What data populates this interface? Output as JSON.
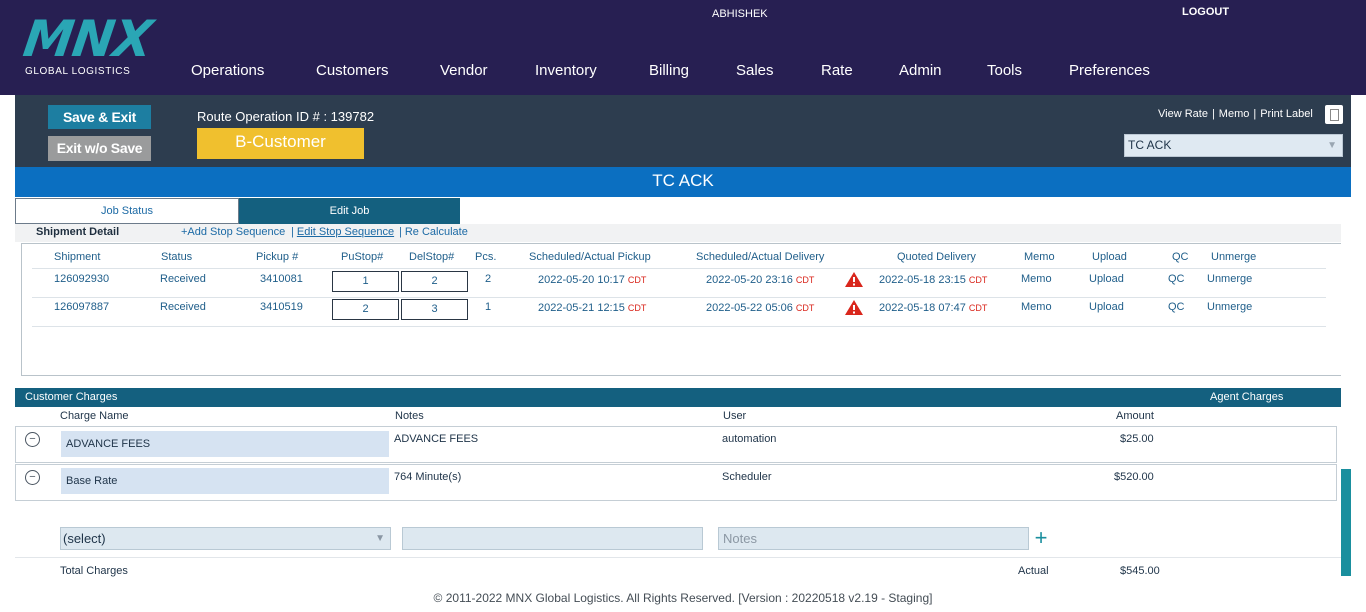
{
  "header": {
    "logo_mark": "MNX",
    "logo_sub": "GLOBAL LOGISTICS",
    "username": "ABHISHEK",
    "logout": "LOGOUT",
    "nav": [
      "Operations",
      "Customers",
      "Vendor",
      "Inventory",
      "Billing",
      "Sales",
      "Rate",
      "Admin",
      "Tools",
      "Preferences"
    ]
  },
  "toolbar": {
    "save_exit": "Save & Exit",
    "exit_wo_save": "Exit w/o Save",
    "route_id": "Route Operation ID # : 139782",
    "customer_tag": "B-Customer",
    "view_rate": "View Rate",
    "memo": "Memo",
    "print_label": "Print Label",
    "status_value": "TC ACK"
  },
  "title": "TC ACK",
  "tabs": {
    "job_status": "Job Status",
    "edit_job": "Edit Job"
  },
  "shipment_detail": {
    "title": "Shipment Detail",
    "add_stop": "+Add Stop Sequence",
    "edit_stop": "Edit Stop Sequence",
    "recalc": "Re Calculate",
    "columns": [
      "Shipment",
      "Status",
      "Pickup #",
      "PuStop#",
      "DelStop#",
      "Pcs.",
      "Scheduled/Actual Pickup",
      "Scheduled/Actual Delivery",
      "Quoted Delivery",
      "Memo",
      "Upload",
      "QC",
      "Unmerge"
    ],
    "rows": [
      {
        "shipment": "126092930",
        "status": "Received",
        "pickup": "3410081",
        "pustop": "1",
        "delstop": "2",
        "pcs": "2",
        "sched_pickup": "2022-05-20 10:17",
        "pickup_tz": "CDT",
        "sched_delivery": "2022-05-20 23:16",
        "delivery_tz": "CDT",
        "quoted": "2022-05-18 23:15",
        "quoted_tz": "CDT",
        "memo": "Memo",
        "upload": "Upload",
        "qc": "QC",
        "unmerge": "Unmerge"
      },
      {
        "shipment": "126097887",
        "status": "Received",
        "pickup": "3410519",
        "pustop": "2",
        "delstop": "3",
        "pcs": "1",
        "sched_pickup": "2022-05-21 12:15",
        "pickup_tz": "CDT",
        "sched_delivery": "2022-05-22 05:06",
        "delivery_tz": "CDT",
        "quoted": "2022-05-18 07:47",
        "quoted_tz": "CDT",
        "memo": "Memo",
        "upload": "Upload",
        "qc": "QC",
        "unmerge": "Unmerge"
      }
    ]
  },
  "charges": {
    "customer_title": "Customer Charges",
    "agent_title": "Agent Charges",
    "columns": {
      "name": "Charge Name",
      "notes": "Notes",
      "user": "User",
      "amount": "Amount"
    },
    "rows": [
      {
        "name": "ADVANCE FEES",
        "notes": "ADVANCE FEES",
        "user": "automation",
        "amount": "$25.00"
      },
      {
        "name": "Base Rate",
        "notes": "764 Minute(s)",
        "user": "Scheduler",
        "amount": "$520.00"
      }
    ],
    "select_placeholder": "(select)",
    "notes_placeholder": "Notes",
    "total_label": "Total Charges",
    "actual_label": "Actual",
    "total_value": "$545.00"
  },
  "footer": "© 2011-2022 MNX Global Logistics. All Rights Reserved. [Version : 20220518 v2.19 - Staging]"
}
